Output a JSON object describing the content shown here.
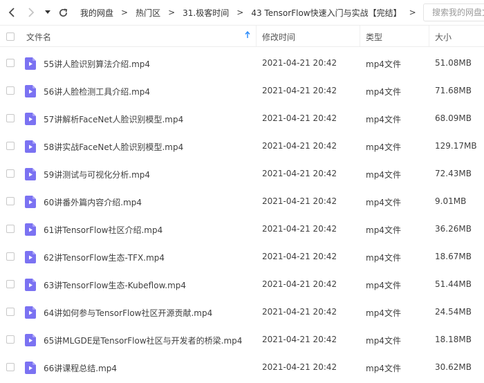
{
  "toolbar": {
    "back_icon": "chevron-left-icon",
    "forward_icon": "chevron-right-icon",
    "history_icon": "caret-down-icon",
    "refresh_icon": "refresh-icon"
  },
  "breadcrumb": {
    "items": [
      "我的网盘",
      "热门区",
      "31.极客时间",
      "43 TensorFlow快速入门与实战【完结】"
    ],
    "separator": ">"
  },
  "search": {
    "placeholder": "搜索我的网盘文件"
  },
  "table": {
    "headers": {
      "name": "文件名",
      "modified": "修改时间",
      "type": "类型",
      "size": "大小"
    },
    "sort_icon": "sort-ascending-arrow-icon",
    "accent_color": "#2f8dfa",
    "file_icon_color": "#7b72f2",
    "rows": [
      {
        "name": "55讲人脸识别算法介绍.mp4",
        "modified": "2021-04-21 20:42",
        "type": "mp4文件",
        "size": "51.08MB"
      },
      {
        "name": "56讲人脸检测工具介绍.mp4",
        "modified": "2021-04-21 20:42",
        "type": "mp4文件",
        "size": "71.68MB"
      },
      {
        "name": "57讲解析FaceNet人脸识别模型.mp4",
        "modified": "2021-04-21 20:42",
        "type": "mp4文件",
        "size": "68.09MB"
      },
      {
        "name": "58讲实战FaceNet人脸识别模型.mp4",
        "modified": "2021-04-21 20:42",
        "type": "mp4文件",
        "size": "129.17MB"
      },
      {
        "name": "59讲测试与可视化分析.mp4",
        "modified": "2021-04-21 20:42",
        "type": "mp4文件",
        "size": "72.43MB"
      },
      {
        "name": "60讲番外篇内容介绍.mp4",
        "modified": "2021-04-21 20:42",
        "type": "mp4文件",
        "size": "9.01MB"
      },
      {
        "name": "61讲TensorFlow社区介绍.mp4",
        "modified": "2021-04-21 20:42",
        "type": "mp4文件",
        "size": "36.26MB"
      },
      {
        "name": "62讲TensorFlow生态-TFX.mp4",
        "modified": "2021-04-21 20:42",
        "type": "mp4文件",
        "size": "18.67MB"
      },
      {
        "name": "63讲TensorFlow生态-Kubeflow.mp4",
        "modified": "2021-04-21 20:42",
        "type": "mp4文件",
        "size": "51.44MB"
      },
      {
        "name": "64讲如何参与TensorFlow社区开源贡献.mp4",
        "modified": "2021-04-21 20:42",
        "type": "mp4文件",
        "size": "24.54MB"
      },
      {
        "name": "65讲MLGDE是TensorFlow社区与开发者的桥梁.mp4",
        "modified": "2021-04-21 20:42",
        "type": "mp4文件",
        "size": "18.18MB"
      },
      {
        "name": "66讲课程总结.mp4",
        "modified": "2021-04-21 20:42",
        "type": "mp4文件",
        "size": "30.62MB"
      }
    ]
  }
}
